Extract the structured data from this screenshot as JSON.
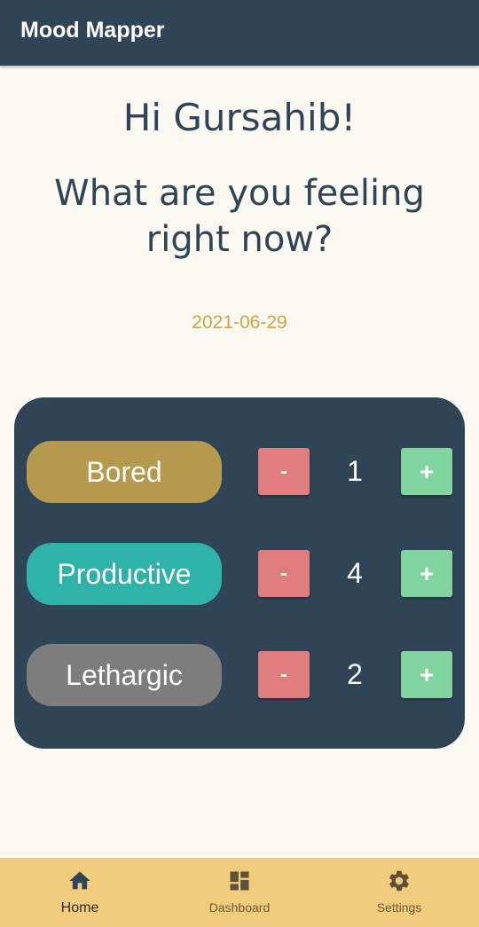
{
  "app": {
    "title": "Mood Mapper"
  },
  "main": {
    "greeting": "Hi Gursahib!",
    "question": "What are you feeling right now?",
    "date": "2021-06-29"
  },
  "moods": [
    {
      "label": "Bored",
      "count": "1",
      "color": "#b5994f",
      "minus_label": "-",
      "plus_label": "+"
    },
    {
      "label": "Productive",
      "count": "4",
      "color": "#2fb3a8",
      "minus_label": "-",
      "plus_label": "+"
    },
    {
      "label": "Lethargic",
      "count": "2",
      "color": "#7d7d7d",
      "minus_label": "-",
      "plus_label": "+"
    }
  ],
  "bottom_nav": {
    "items": [
      {
        "label": "Home",
        "icon": "home-icon",
        "active": true
      },
      {
        "label": "Dashboard",
        "icon": "dashboard-icon",
        "active": false
      },
      {
        "label": "Settings",
        "icon": "gear-icon",
        "active": false
      }
    ]
  },
  "colors": {
    "primary": "#2f4557",
    "accent_date": "#c9a63f",
    "minus": "#e07d7f",
    "plus": "#7fd59d",
    "nav_background": "#f2cc7d"
  }
}
